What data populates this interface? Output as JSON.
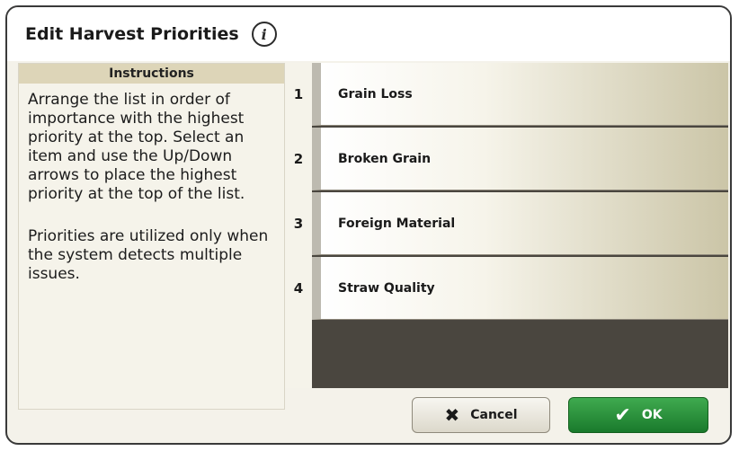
{
  "dialog": {
    "title": "Edit Harvest Priorities",
    "info_icon": "i"
  },
  "instructions": {
    "header": "Instructions",
    "paragraph1": "Arrange the list in order of importance with the highest priority at the top. Select an item and use the Up/Down arrows to place the highest priority at the top of the list.",
    "paragraph2": "Priorities are utilized only when the system detects multiple issues."
  },
  "priorities": [
    {
      "number": "1",
      "label": "Grain Loss"
    },
    {
      "number": "2",
      "label": "Broken Grain"
    },
    {
      "number": "3",
      "label": "Foreign Material"
    },
    {
      "number": "4",
      "label": "Straw Quality"
    }
  ],
  "buttons": {
    "cancel_label": "Cancel",
    "cancel_icon": "x-icon",
    "ok_label": "OK",
    "ok_icon": "check-icon"
  },
  "colors": {
    "ok_green": "#2a9a3c",
    "header_tan": "#ddd5b8",
    "list_background": "#4a463f"
  }
}
